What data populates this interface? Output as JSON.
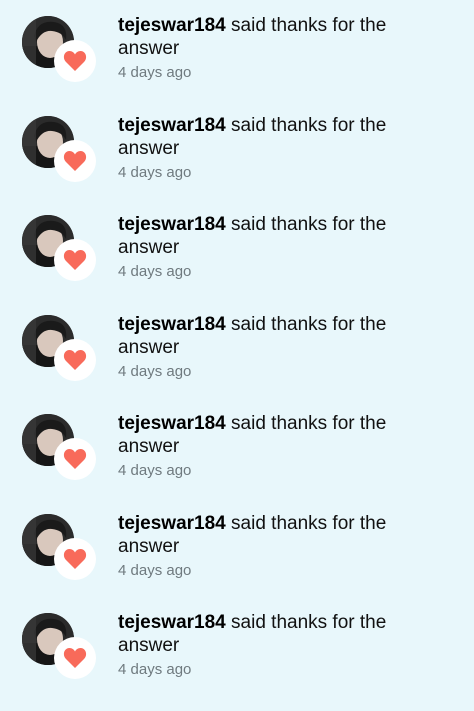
{
  "colors": {
    "background": "#e8f7fb",
    "heart": "#f86a5a",
    "timestamp": "#6f7a7f"
  },
  "notifications": [
    {
      "username": "tejeswar184",
      "action": "said thanks for the answer",
      "time": "4 days ago",
      "icon": "heart-icon"
    },
    {
      "username": "tejeswar184",
      "action": "said thanks for the answer",
      "time": "4 days ago",
      "icon": "heart-icon"
    },
    {
      "username": "tejeswar184",
      "action": "said thanks for the answer",
      "time": "4 days ago",
      "icon": "heart-icon"
    },
    {
      "username": "tejeswar184",
      "action": "said thanks for the answer",
      "time": "4 days ago",
      "icon": "heart-icon"
    },
    {
      "username": "tejeswar184",
      "action": "said thanks for the answer",
      "time": "4 days ago",
      "icon": "heart-icon"
    },
    {
      "username": "tejeswar184",
      "action": "said thanks for the answer",
      "time": "4 days ago",
      "icon": "heart-icon"
    },
    {
      "username": "tejeswar184",
      "action": "said thanks for the answer",
      "time": "4 days ago",
      "icon": "heart-icon"
    }
  ]
}
